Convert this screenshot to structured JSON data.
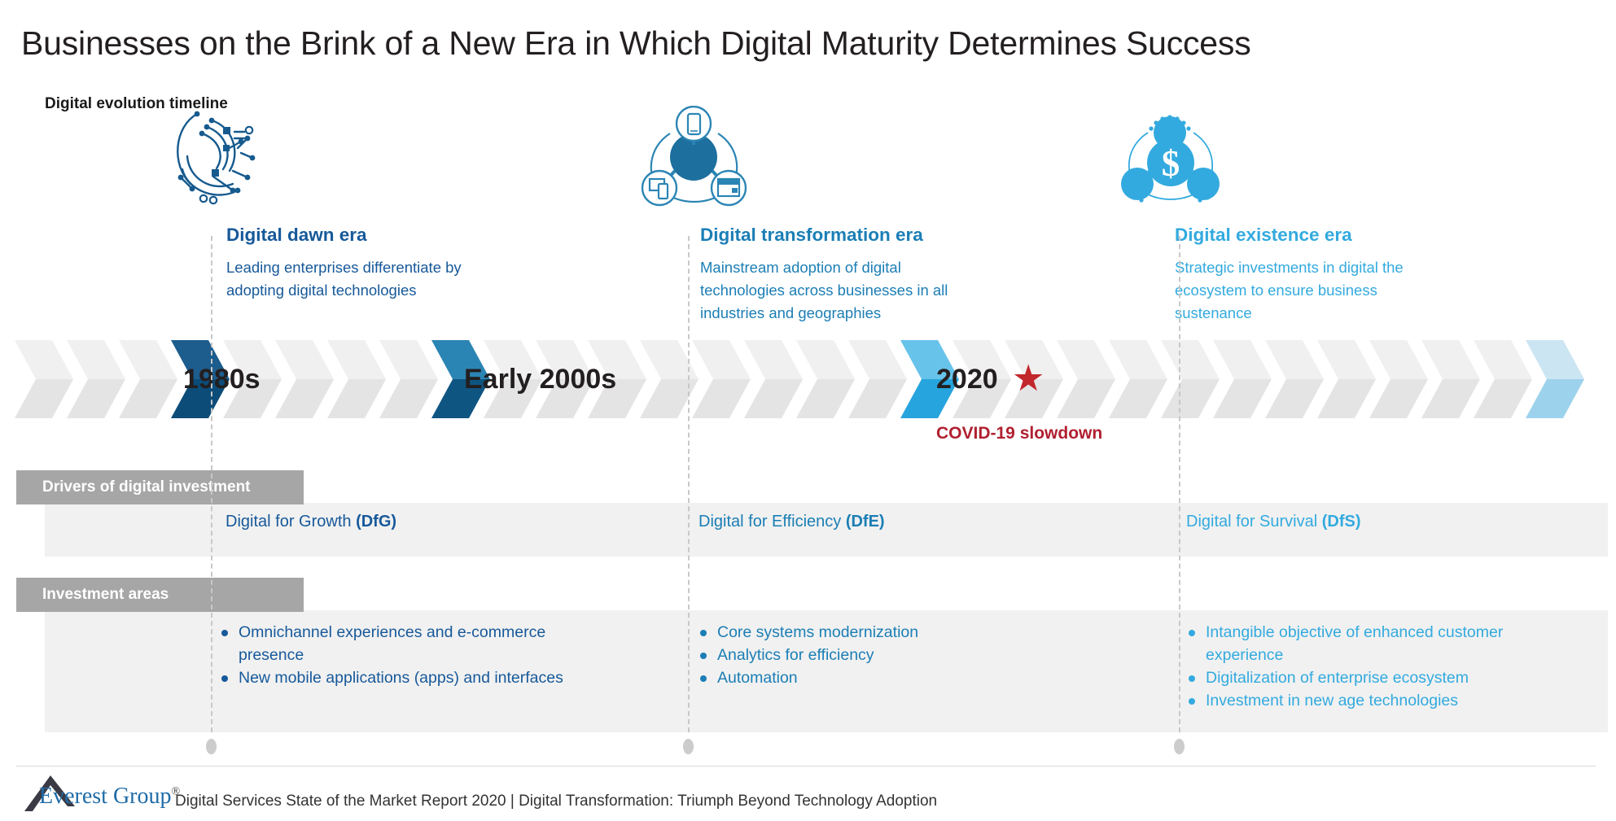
{
  "title": "Businesses on the Brink of a New Era in Which Digital Maturity Determines Success",
  "section_label": "Digital evolution timeline",
  "eras": [
    {
      "heading": "Digital dawn era",
      "description": "Leading enterprises differentiate by adopting digital technologies",
      "marker": "1980s",
      "icon": "digital-network-swirl-icon",
      "color": "#17599a"
    },
    {
      "heading": "Digital transformation era",
      "description": "Mainstream adoption of digital technologies across businesses in all industries and geographies",
      "marker": "Early 2000s",
      "icon": "connected-devices-hub-icon",
      "color": "#1b7eb5"
    },
    {
      "heading": "Digital existence era",
      "description": "Strategic investments in digital the ecosystem to ensure business sustenance",
      "marker": "2020",
      "icon": "dollar-ecosystem-network-icon",
      "color": "#33aadf"
    }
  ],
  "covid_marker": {
    "star_icon": "red-star-icon",
    "label": "COVID-19  slowdown",
    "color": "#b02030"
  },
  "rows": [
    {
      "tag": "Drivers of digital investment",
      "cells": [
        {
          "text": "Digital for Growth ",
          "emphasis": "(DfG)"
        },
        {
          "text": "Digital for Efficiency ",
          "emphasis": "(DfE)"
        },
        {
          "text": "Digital for Survival ",
          "emphasis": "(DfS)"
        }
      ]
    },
    {
      "tag": "Investment areas",
      "cells": [
        {
          "items": [
            "Omnichannel experiences and e-commerce presence",
            "New mobile applications (apps) and interfaces"
          ]
        },
        {
          "items": [
            "Core systems modernization",
            "Analytics for efficiency",
            "Automation"
          ]
        },
        {
          "items": [
            "Intangible objective of enhanced customer experience",
            "Digitalization of enterprise ecosystem",
            "Investment in new age technologies"
          ]
        }
      ]
    }
  ],
  "footer": {
    "logo_name": "Everest Group",
    "logo_registered": "®",
    "source": "Digital Services State of the Market Report 2020 | Digital Transformation: Triumph Beyond Technology Adoption"
  }
}
